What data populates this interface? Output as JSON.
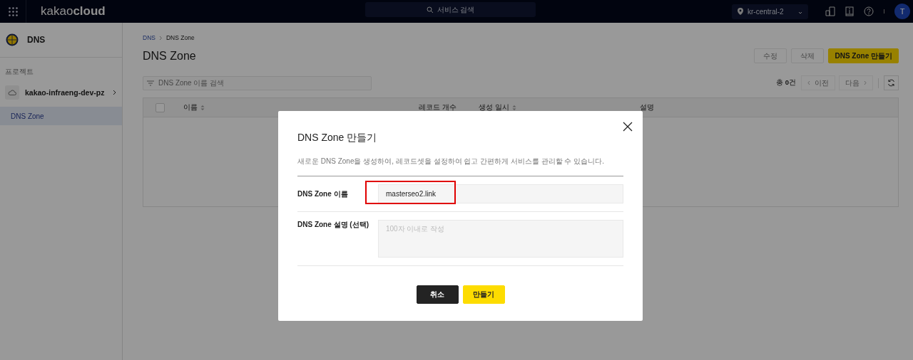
{
  "topbar": {
    "logo_light": "kakao",
    "logo_bold": "cloud",
    "search": {
      "placeholder": "서비스 검색"
    },
    "region": "kr-central-2",
    "avatar": "T"
  },
  "sidebar": {
    "service": "DNS",
    "section_label": "프로젝트",
    "project": "kakao-infraeng-dev-pz",
    "items": [
      {
        "label": "DNS Zone",
        "selected": true
      }
    ]
  },
  "breadcrumb": [
    {
      "label": "DNS",
      "kind": "link"
    },
    {
      "label": "DNS Zone",
      "kind": "current"
    }
  ],
  "page_title": "DNS Zone",
  "actions": [
    {
      "label": "수정",
      "kind": "secondary",
      "disabled": true
    },
    {
      "label": "삭제",
      "kind": "secondary",
      "disabled": true
    },
    {
      "label": "DNS Zone 만들기",
      "kind": "primary",
      "disabled": false
    }
  ],
  "filter": {
    "placeholder": "DNS Zone 이름 검색"
  },
  "total": {
    "prefix": "총 ",
    "count": "0",
    "suffix": "건"
  },
  "pagination": [
    {
      "label": "이전",
      "kind": "prev",
      "disabled": true
    },
    {
      "label": "다음",
      "kind": "next",
      "disabled": true
    }
  ],
  "table": {
    "select_all": {
      "checked": false
    },
    "columns": [
      {
        "label": "이름",
        "sortable": true
      },
      {
        "label": "레코드 개수",
        "sortable": false
      },
      {
        "label": "생성 일시",
        "sortable": true
      },
      {
        "label": "설명",
        "sortable": false
      }
    ]
  },
  "dialog": {
    "title": "DNS Zone 만들기",
    "description": "새로운 DNS Zone을 생성하여, 레코드셋을 설정하여 쉽고 간편하게 서비스를 관리할 수 있습니다.",
    "fields": [
      {
        "label": "DNS Zone 이름",
        "kind": "input",
        "value": "masterseo2.link",
        "highlighted": true
      },
      {
        "label": "DNS Zone 설명 (선택)",
        "kind": "textarea",
        "placeholder": "100자 이내로 작성",
        "highlighted": false
      }
    ],
    "buttons": [
      {
        "label": "취소",
        "kind": "secondary"
      },
      {
        "label": "만들기",
        "kind": "primary"
      }
    ]
  }
}
